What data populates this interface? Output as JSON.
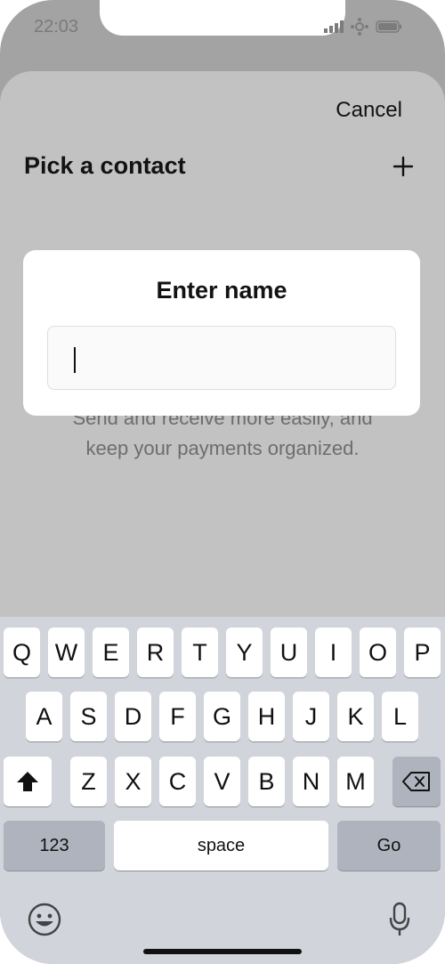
{
  "status": {
    "time": "22:03"
  },
  "sheet": {
    "cancel_label": "Cancel",
    "title": "Pick a contact",
    "empty_text_line1": "Send and receive more easily, and",
    "empty_text_line2": "keep your payments organized."
  },
  "dialog": {
    "title": "Enter name",
    "input_value": ""
  },
  "keyboard": {
    "row1": [
      "Q",
      "W",
      "E",
      "R",
      "T",
      "Y",
      "U",
      "I",
      "O",
      "P"
    ],
    "row2": [
      "A",
      "S",
      "D",
      "F",
      "G",
      "H",
      "J",
      "K",
      "L"
    ],
    "row3": [
      "Z",
      "X",
      "C",
      "V",
      "B",
      "N",
      "M"
    ],
    "numbers_label": "123",
    "space_label": "space",
    "go_label": "Go"
  },
  "icons": {
    "signal": "signal-icon",
    "network": "network-icon",
    "battery": "battery-icon",
    "add": "plus-icon",
    "shift": "shift-icon",
    "backspace": "backspace-icon",
    "emoji": "emoji-icon",
    "microphone": "microphone-icon"
  }
}
